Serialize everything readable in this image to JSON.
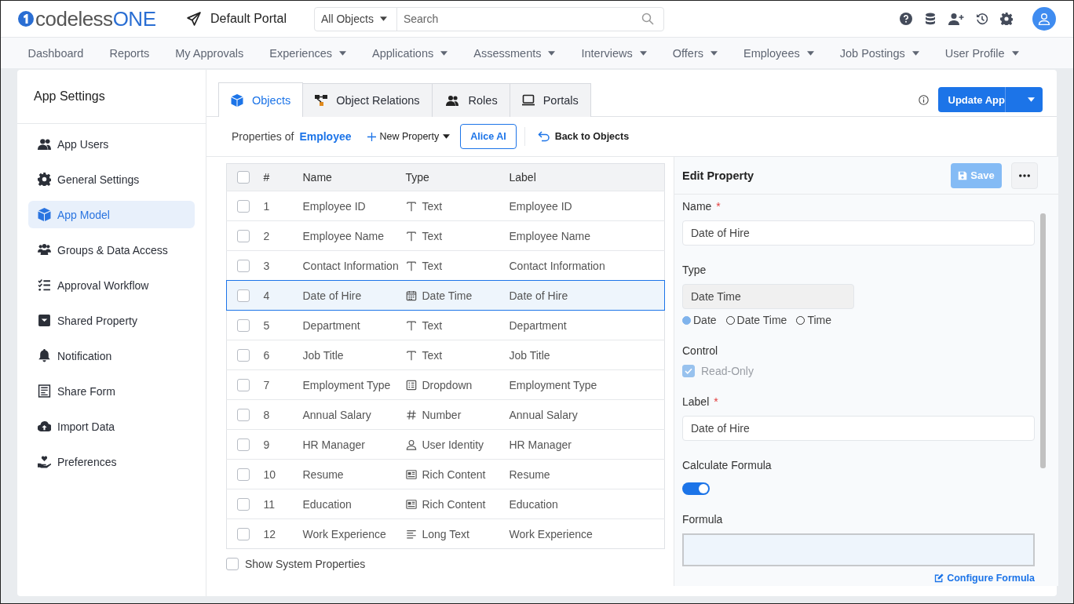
{
  "logo": {
    "name": "codeless",
    "suffix": "ONE"
  },
  "header": {
    "portal": "Default Portal",
    "search": {
      "scope": "All Objects",
      "placeholder": "Search"
    }
  },
  "nav": [
    {
      "label": "Dashboard",
      "dropdown": false
    },
    {
      "label": "Reports",
      "dropdown": false
    },
    {
      "label": "My Approvals",
      "dropdown": false
    },
    {
      "label": "Experiences",
      "dropdown": true
    },
    {
      "label": "Applications",
      "dropdown": true
    },
    {
      "label": "Assessments",
      "dropdown": true
    },
    {
      "label": "Interviews",
      "dropdown": true
    },
    {
      "label": "Offers",
      "dropdown": true
    },
    {
      "label": "Employees",
      "dropdown": true
    },
    {
      "label": "Job Postings",
      "dropdown": true
    },
    {
      "label": "User Profile",
      "dropdown": true
    }
  ],
  "sidebar": {
    "title": "App Settings",
    "items": [
      {
        "label": "App Users",
        "selected": false
      },
      {
        "label": "General Settings",
        "selected": false
      },
      {
        "label": "App Model",
        "selected": true
      },
      {
        "label": "Groups & Data Access",
        "selected": false
      },
      {
        "label": "Approval Workflow",
        "selected": false
      },
      {
        "label": "Shared Property",
        "selected": false
      },
      {
        "label": "Notification",
        "selected": false
      },
      {
        "label": "Share Form",
        "selected": false
      },
      {
        "label": "Import Data",
        "selected": false
      },
      {
        "label": "Preferences",
        "selected": false
      }
    ]
  },
  "tabs": [
    {
      "label": "Objects",
      "selected": true
    },
    {
      "label": "Object Relations",
      "selected": false
    },
    {
      "label": "Roles",
      "selected": false
    },
    {
      "label": "Portals",
      "selected": false
    }
  ],
  "update_button": "Update App",
  "toolbar": {
    "caption": "Properties of",
    "object": "Employee",
    "new_property": "New Property",
    "ai_button": "Alice AI",
    "back": "Back to Objects"
  },
  "table": {
    "all_checked": false,
    "columns": [
      "#",
      "Name",
      "Type",
      "Label"
    ],
    "rows": [
      {
        "number": "1",
        "name": "Employee ID",
        "type": "Text",
        "kind": "text",
        "label": "Employee ID",
        "checked": false,
        "selected": false
      },
      {
        "number": "2",
        "name": "Employee Name",
        "type": "Text",
        "kind": "text",
        "label": "Employee Name",
        "checked": false,
        "selected": false
      },
      {
        "number": "3",
        "name": "Contact Information",
        "type": "Text",
        "kind": "text",
        "label": "Contact Information",
        "checked": false,
        "selected": false
      },
      {
        "number": "4",
        "name": "Date of Hire",
        "type": "Date Time",
        "kind": "date",
        "label": "Date of Hire",
        "checked": false,
        "selected": true
      },
      {
        "number": "5",
        "name": "Department",
        "type": "Text",
        "kind": "text",
        "label": "Department",
        "checked": false,
        "selected": false
      },
      {
        "number": "6",
        "name": "Job Title",
        "type": "Text",
        "kind": "text",
        "label": "Job Title",
        "checked": false,
        "selected": false
      },
      {
        "number": "7",
        "name": "Employment Type",
        "type": "Dropdown",
        "kind": "dropdown",
        "label": "Employment Type",
        "checked": false,
        "selected": false
      },
      {
        "number": "8",
        "name": "Annual Salary",
        "type": "Number",
        "kind": "number",
        "label": "Annual Salary",
        "checked": false,
        "selected": false
      },
      {
        "number": "9",
        "name": "HR Manager",
        "type": "User Identity",
        "kind": "user",
        "label": "HR Manager",
        "checked": false,
        "selected": false
      },
      {
        "number": "10",
        "name": "Resume",
        "type": "Rich Content",
        "kind": "rich",
        "label": "Resume",
        "checked": false,
        "selected": false
      },
      {
        "number": "11",
        "name": "Education",
        "type": "Rich Content",
        "kind": "rich",
        "label": "Education",
        "checked": false,
        "selected": false
      },
      {
        "number": "12",
        "name": "Work Experience",
        "type": "Long Text",
        "kind": "longtext",
        "label": "Work Experience",
        "checked": false,
        "selected": false
      }
    ]
  },
  "show_system": {
    "label": "Show System Properties",
    "checked": false
  },
  "editor": {
    "title": "Edit Property",
    "save": {
      "label": "Save",
      "disabled": true
    },
    "fields": [
      {
        "kind": "input",
        "label": "Name",
        "required_mark": "*",
        "value": "Date of Hire"
      },
      {
        "kind": "readonly",
        "label": "Type",
        "value": "Date Time"
      },
      {
        "kind": "radios",
        "options": [
          {
            "label": "Date",
            "selected": true
          },
          {
            "label": "Date Time",
            "selected": false
          },
          {
            "label": "Time",
            "selected": false
          }
        ]
      },
      {
        "kind": "checkbox",
        "label": "Control",
        "option": "Read-Only",
        "checked": true,
        "disabled": true
      },
      {
        "kind": "input",
        "label": "Label",
        "required_mark": "*",
        "value": "Date of Hire"
      },
      {
        "kind": "toggle",
        "label": "Calculate Formula",
        "on": true
      },
      {
        "kind": "textarea",
        "label": "Formula"
      }
    ],
    "link": "Configure Formula"
  }
}
